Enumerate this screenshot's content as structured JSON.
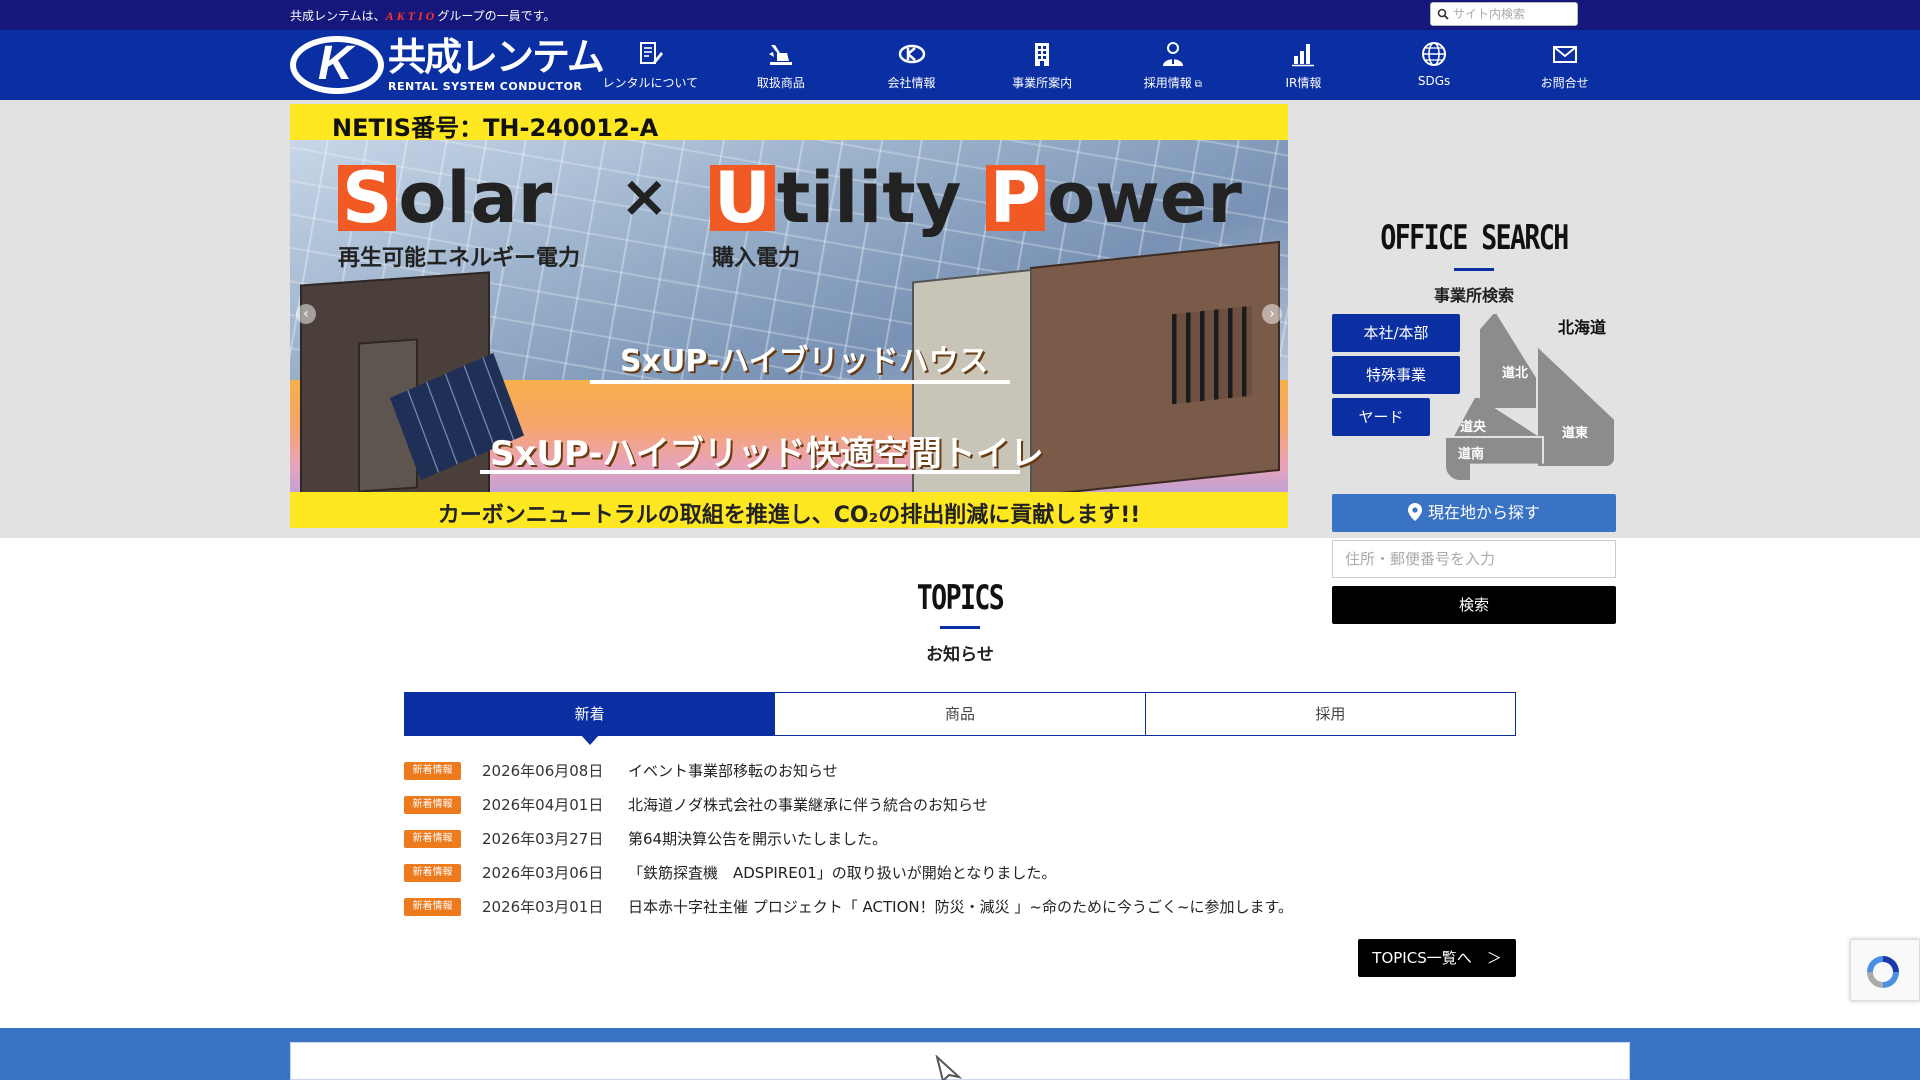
{
  "topbar": {
    "notice_pre": "共成レンテムは、",
    "notice_brand": "AKTIO",
    "notice_post": "グループの一員です。",
    "search_placeholder": "サイト内検索"
  },
  "header": {
    "logo_mark": "K",
    "logo_name": "共成レンテム",
    "logo_sub": "RENTAL SYSTEM CONDUCTOR",
    "nav": [
      {
        "label": "レンタルについて",
        "icon": "document-pen-icon"
      },
      {
        "label": "取扱商品",
        "icon": "excavator-icon"
      },
      {
        "label": "会社情報",
        "icon": "company-logo-icon"
      },
      {
        "label": "事業所案内",
        "icon": "building-icon"
      },
      {
        "label": "採用情報",
        "icon": "person-icon",
        "external": "⧉"
      },
      {
        "label": "IR情報",
        "icon": "bar-chart-icon"
      },
      {
        "label": "SDGs",
        "icon": "globe-icon"
      },
      {
        "label": "お問合せ",
        "icon": "mail-icon"
      }
    ]
  },
  "banner": {
    "netis": "NETIS番号：TH-240012-A",
    "solar_cap": "S",
    "solar_rest": "olar",
    "solar_sub": "再生可能エネルギー電力",
    "times": "×",
    "utility_cap": "U",
    "utility_rest": "tility",
    "power_cap": "P",
    "power_rest": "ower",
    "utility_sub": "購入電力",
    "line1": "SxUP-ハイブリッドハウス",
    "line2": "SxUP-ハイブリッド快適空間トイレ",
    "bottom": "カーボンニュートラルの取組を推進し、CO₂の排出削減に貢献します!!",
    "prev": "‹",
    "next": "›"
  },
  "office_search": {
    "title": "OFFICE SEARCH",
    "subtitle": "事業所検索",
    "buttons": [
      "本社/本部",
      "特殊事業",
      "ヤード"
    ],
    "map_title": "北海道",
    "regions": [
      "道北",
      "道央",
      "道南",
      "道東"
    ],
    "location_button": "現在地から探す",
    "address_placeholder": "住所・郵便番号を入力",
    "search_button": "検索"
  },
  "topics": {
    "title": "TOPICS",
    "subtitle": "お知らせ",
    "tabs": [
      "新着",
      "商品",
      "採用"
    ],
    "active_tab": 0,
    "items": [
      {
        "badge": "新着情報",
        "date": "2026年06月08日",
        "title": "イベント事業部移転のお知らせ"
      },
      {
        "badge": "新着情報",
        "date": "2026年04月01日",
        "title": "北海道ノダ株式会社の事業継承に伴う統合のお知らせ"
      },
      {
        "badge": "新着情報",
        "date": "2026年03月27日",
        "title": "第64期決算公告を開示いたしました。"
      },
      {
        "badge": "新着情報",
        "date": "2026年03月06日",
        "title": "「鉄筋探査機　ADSPIRE01」の取り扱いが開始となりました。"
      },
      {
        "badge": "新着情報",
        "date": "2026年03月01日",
        "title": "日本赤十字社主催 プロジェクト「 ACTION！防災・減災 」~命のために今うごく~に参加します。"
      }
    ],
    "more_button": "TOPICS一覧へ　＞"
  },
  "colors": {
    "topbar": "#15187a",
    "header": "#0a2fa3",
    "badge": "#ee7a1e",
    "location_button": "#3a73c4"
  }
}
